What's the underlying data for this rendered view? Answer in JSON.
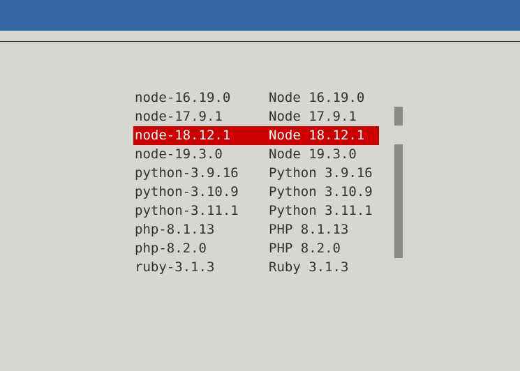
{
  "colors": {
    "header_bar": "#3465a4",
    "background": "#d5d7d0",
    "selection": "#cc0000",
    "scrollbar": "#888a85",
    "text": "#2e3436"
  },
  "menu": {
    "selected_index": 2,
    "items": [
      {
        "name": "node-16.19.0",
        "description": "Node 16.19.0"
      },
      {
        "name": "node-17.9.1",
        "description": "Node 17.9.1"
      },
      {
        "name": "node-18.12.1",
        "description": "Node 18.12.1"
      },
      {
        "name": "node-19.3.0",
        "description": "Node 19.3.0"
      },
      {
        "name": "python-3.9.16",
        "description": "Python 3.9.16"
      },
      {
        "name": "python-3.10.9",
        "description": "Python 3.10.9"
      },
      {
        "name": "python-3.11.1",
        "description": "Python 3.11.1"
      },
      {
        "name": "php-8.1.13",
        "description": "PHP 8.1.13"
      },
      {
        "name": "php-8.2.0",
        "description": "PHP 8.2.0"
      },
      {
        "name": "ruby-3.1.3",
        "description": "Ruby 3.1.3"
      }
    ]
  }
}
